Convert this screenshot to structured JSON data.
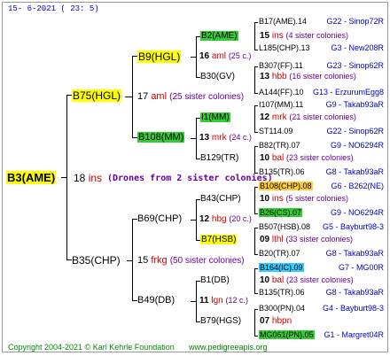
{
  "header": {
    "date": "15-  6-2021 (  23:  5)"
  },
  "footer": {
    "copyright": "Copyright 2004-2021 © Karl Kehrle Foundation",
    "url": "www.pedigreeapis.org"
  },
  "root": {
    "id": "B3(AME)",
    "num": "18",
    "race": "ins",
    "note": "(Drones from 2 sister colonies)"
  },
  "gen1": {
    "top": {
      "id": "B75(HGL)",
      "num": "17",
      "race": "aml",
      "note": "(25 sister colonies)"
    },
    "bottom": {
      "id": "B35(CHP)",
      "num": "15",
      "race": "frkg",
      "note": "(50 sister colonies)"
    }
  },
  "gen2": {
    "a": {
      "id": "B9(HGL)",
      "num": "16",
      "race": "aml",
      "note": "(25 c.)"
    },
    "b": {
      "id": "B108(MM)",
      "num": "13",
      "race": "mrk",
      "note": "(24 c.)"
    },
    "c": {
      "id": "B69(CHP)",
      "num": "12",
      "race": "hbg",
      "note": "(20 c.)"
    },
    "d": {
      "id": "B49(DB)",
      "num": "11",
      "race": "lgn",
      "note": "(12 c.)"
    }
  },
  "gen3": {
    "a1": {
      "id": "B2(AME)",
      "num": "15",
      "race": "ins",
      "note": "(4 sister colonies)"
    },
    "a2": {
      "id": "B30(GV)",
      "num": "13",
      "race": "hbb",
      "note": "(16 sister colonies)"
    },
    "b1": {
      "id": "I1(MM)",
      "num": "12",
      "race": "mrk",
      "note": "(21 sister colonies)"
    },
    "b2": {
      "id": "B129(TR)",
      "num": "10",
      "race": "bal",
      "note": "(23 sister colonies)"
    },
    "c1": {
      "id": "B43(CHP)",
      "num": "10",
      "race": "ins",
      "note": "(5 sister colonies)"
    },
    "c2": {
      "id": "B7(HSB)",
      "num": "09",
      "race": "lthl",
      "note": "(33 sister colonies)"
    },
    "d1": {
      "id": "B1(DB)",
      "num": "10",
      "race": "bal",
      "note": "(23 sister colonies)"
    },
    "d2": {
      "id": "B79(HGS)",
      "num": "07",
      "race": "hbpn",
      "note": ""
    }
  },
  "gen4": [
    {
      "id": "B17(AME).14",
      "ref": "G22 - Sinop72R"
    },
    {
      "id": "L185(CHP).13",
      "ref": "G3 - New208R"
    },
    {
      "id": "B307(FF).11",
      "ref": "G23 - Sinop62R"
    },
    {
      "id": "A144(FF).10",
      "ref": "G13 - ErzurumEgg8"
    },
    {
      "id": "I107(MM).11",
      "ref": "G9 - Takab93aR"
    },
    {
      "id": "ST114.09",
      "ref": "G22 - Sinop62R"
    },
    {
      "id": "B82(TR).07",
      "ref": "G9 - NO6294R"
    },
    {
      "id": "B135(TR).06",
      "ref": "G8 - Takab93aR"
    },
    {
      "id": "B108(CHP).08",
      "ref": "G6 - B262(NE)"
    },
    {
      "id": "B26(CS).07",
      "ref": "G9 - NO6294R"
    },
    {
      "id": "B507(HSB).08",
      "ref": "G5 - Bayburt98-3"
    },
    {
      "id": "B20(TR).07",
      "ref": "G8 - Takab93aR"
    },
    {
      "id": "B164(IC).09",
      "ref": "G7 - MG00R"
    },
    {
      "id": "B135(TR).06",
      "ref": "G8 - Takab93aR"
    },
    {
      "id": "B300(PN).04",
      "ref": "G4 - Bayburt98-3"
    },
    {
      "id": "MG061(PN).05",
      "ref": "G1 - Margret04R"
    }
  ],
  "colors": {
    "yellow": "#ffff00",
    "green": "#33cc33",
    "cyan": "#33ccff",
    "orange": "#ffcc33",
    "blue": "#0000cc",
    "red": "#cc0000"
  }
}
